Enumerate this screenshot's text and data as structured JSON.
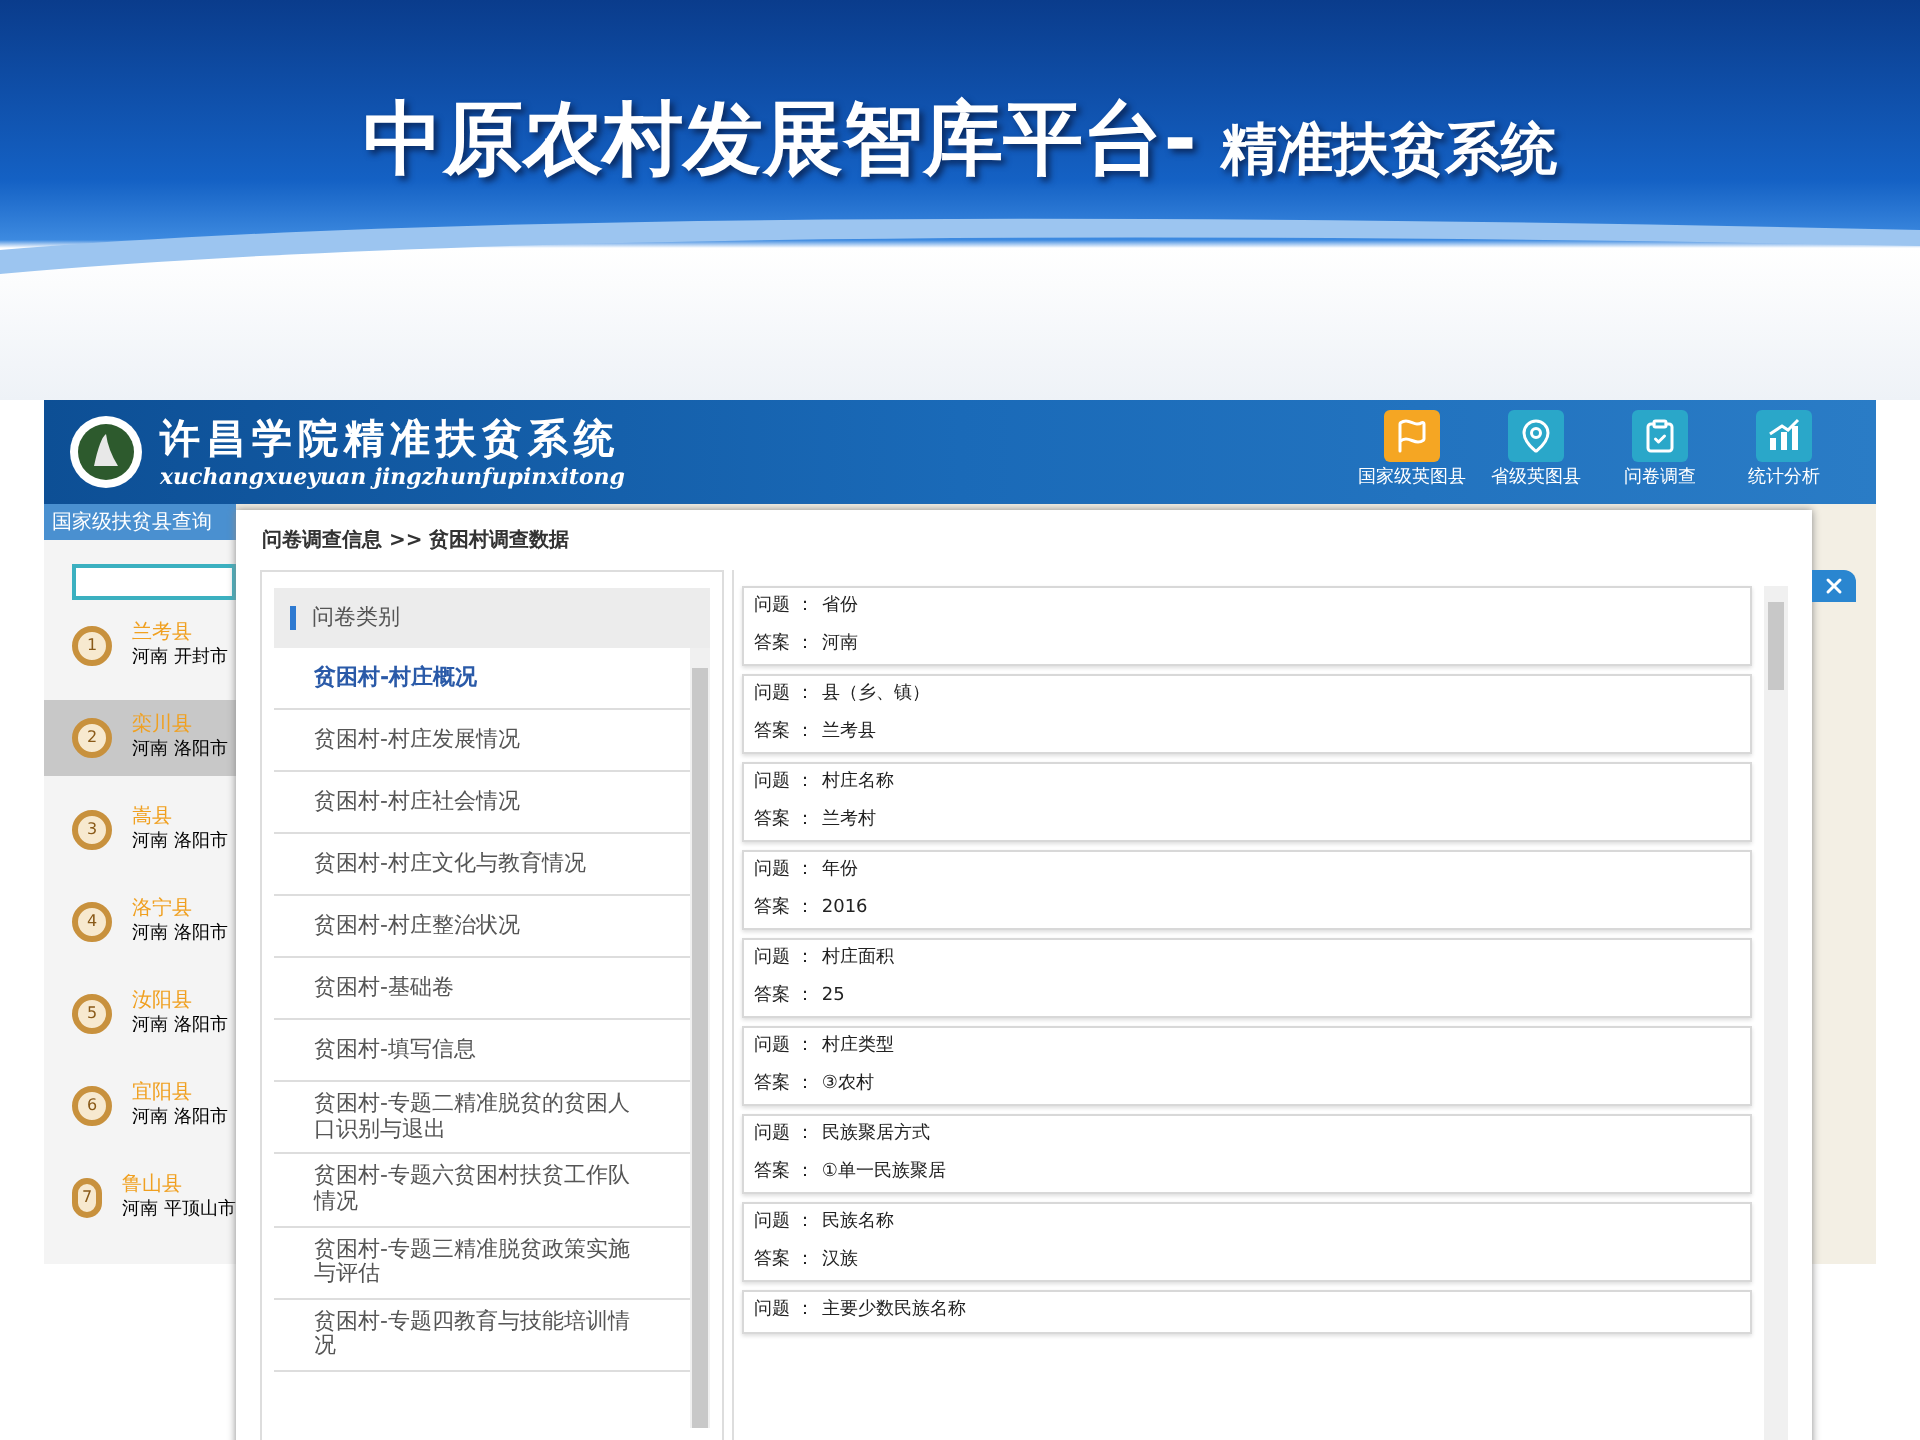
{
  "slide_title": {
    "main": "中原农村发展智库平台-",
    "sub": "精准扶贫系统"
  },
  "app": {
    "logo_title": "许昌学院精准扶贫系统",
    "logo_pinyin": "xuchangxueyuan jingzhunfupinxitong",
    "nav": [
      {
        "kind": "flag",
        "label": "国家级英图县",
        "color": "#f5a623"
      },
      {
        "kind": "pin",
        "label": "省级英图县",
        "color": "#2aa7c9"
      },
      {
        "kind": "survey",
        "label": "问卷调查",
        "color": "#2aa7c9"
      },
      {
        "kind": "chart",
        "label": "统计分析",
        "color": "#2aa7c9"
      }
    ]
  },
  "sidebar": {
    "title": "国家级扶贫县查询",
    "counties": [
      {
        "number": "1",
        "name": "兰考县",
        "region": "河南 开封市",
        "selected": false
      },
      {
        "number": "2",
        "name": "栾川县",
        "region": "河南 洛阳市",
        "selected": true
      },
      {
        "number": "3",
        "name": "嵩县",
        "region": "河南 洛阳市",
        "selected": false
      },
      {
        "number": "4",
        "name": "洛宁县",
        "region": "河南 洛阳市",
        "selected": false
      },
      {
        "number": "5",
        "name": "汝阳县",
        "region": "河南 洛阳市",
        "selected": false
      },
      {
        "number": "6",
        "name": "宜阳县",
        "region": "河南 洛阳市",
        "selected": false
      },
      {
        "number": "7",
        "name": "鲁山县",
        "region": "河南 平顶山市",
        "selected": false
      }
    ]
  },
  "dialog": {
    "breadcrumb": "问卷调查信息 >> 贫困村调查数据",
    "category_header": "问卷类别",
    "categories": [
      {
        "label": "贫困村-村庄概况",
        "selected": true
      },
      {
        "label": "贫困村-村庄发展情况",
        "selected": false
      },
      {
        "label": "贫困村-村庄社会情况",
        "selected": false
      },
      {
        "label": "贫困村-村庄文化与教育情况",
        "selected": false
      },
      {
        "label": "贫困村-村庄整治状况",
        "selected": false
      },
      {
        "label": "贫困村-基础卷",
        "selected": false
      },
      {
        "label": "贫困村-填写信息",
        "selected": false
      },
      {
        "label": "贫困村-专题二精准脱贫的贫困人口识别与退出",
        "selected": false
      },
      {
        "label": "贫困村-专题六贫困村扶贫工作队情况",
        "selected": false
      },
      {
        "label": "贫困村-专题三精准脱贫政策实施与评估",
        "selected": false
      },
      {
        "label": "贫困村-专题四教育与技能培训情况",
        "selected": false
      }
    ],
    "answers": [
      {
        "question_label": "问题 ：",
        "question": "省份",
        "answer_label": "答案 ：",
        "answer": "河南"
      },
      {
        "question_label": "问题 ：",
        "question": "县（乡、镇）",
        "answer_label": "答案 ：",
        "answer": "兰考县"
      },
      {
        "question_label": "问题 ：",
        "question": "村庄名称",
        "answer_label": "答案 ：",
        "answer": "兰考村"
      },
      {
        "question_label": "问题 ：",
        "question": "年份",
        "answer_label": "答案 ：",
        "answer": "2016"
      },
      {
        "question_label": "问题 ：",
        "question": "村庄面积",
        "answer_label": "答案 ：",
        "answer": "25"
      },
      {
        "question_label": "问题 ：",
        "question": "村庄类型",
        "answer_label": "答案 ：",
        "answer": "③农村"
      },
      {
        "question_label": "问题 ：",
        "question": "民族聚居方式",
        "answer_label": "答案 ：",
        "answer": "①单一民族聚居"
      },
      {
        "question_label": "问题 ：",
        "question": "民族名称",
        "answer_label": "答案 ：",
        "answer": "汉族"
      },
      {
        "question_label": "问题 ：",
        "question": "主要少数民族名称"
      }
    ]
  }
}
